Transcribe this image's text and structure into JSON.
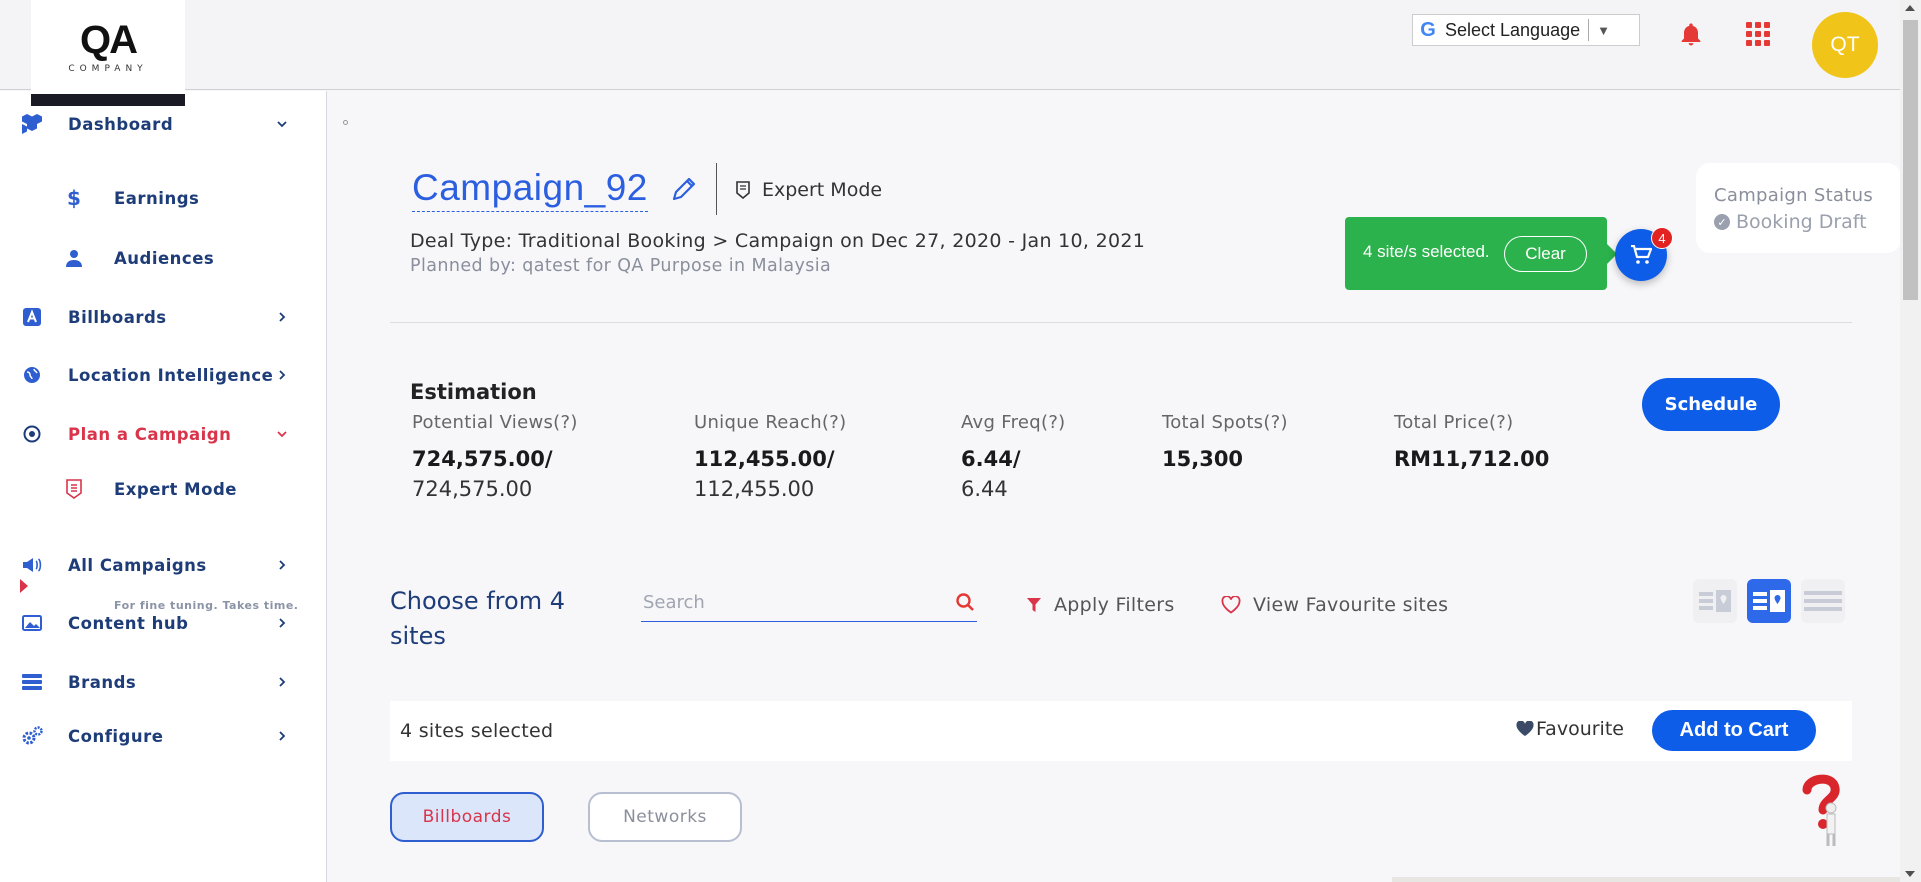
{
  "header": {
    "logo_text": "QA",
    "logo_sub": "COMPANY",
    "language_label": "Select Language",
    "avatar_initials": "QT",
    "accent_color": "#0d5de8",
    "alert_color": "#e53935",
    "avatar_color": "#f0c419"
  },
  "sidebar": {
    "items": [
      {
        "label": "Dashboard",
        "icon": "cubes-icon"
      },
      {
        "label": "Earnings",
        "icon": "dollar-icon"
      },
      {
        "label": "Audiences",
        "icon": "user-icon"
      },
      {
        "label": "Billboards",
        "icon": "billboard-a-icon"
      },
      {
        "label": "Location Intelligence",
        "icon": "globe-icon"
      },
      {
        "label": "Plan a Campaign",
        "icon": "target-icon"
      },
      {
        "label": "Expert Mode",
        "icon": "badge-icon",
        "description": "For fine tuning. Takes time."
      },
      {
        "label": "All Campaigns",
        "icon": "megaphone-icon"
      },
      {
        "label": "Content hub",
        "icon": "image-icon"
      },
      {
        "label": "Brands",
        "icon": "stack-icon"
      },
      {
        "label": "Configure",
        "icon": "gears-icon"
      }
    ]
  },
  "campaign": {
    "title": "Campaign_92",
    "mode": "Expert Mode",
    "deal_line": "Deal Type: Traditional Booking > Campaign on Dec 27, 2020 - Jan 10, 2021",
    "planned_by": "Planned by: qatest for QA Purpose in Malaysia",
    "status_label": "Campaign Status",
    "status_value": "Booking Draft"
  },
  "toast": {
    "message": "4 site/s selected.",
    "clear_label": "Clear",
    "cart_count": "4"
  },
  "estimation": {
    "title": "Estimation",
    "metrics": [
      {
        "label": "Potential Views(?)",
        "value": "724,575.00/",
        "sub": "724,575.00"
      },
      {
        "label": "Unique Reach(?)",
        "value": "112,455.00/",
        "sub": "112,455.00"
      },
      {
        "label": "Avg Freq(?)",
        "value": "6.44/",
        "sub": "6.44"
      },
      {
        "label": "Total Spots(?)",
        "value": "15,300",
        "sub": ""
      },
      {
        "label": "Total Price(?)",
        "value": "RM11,712.00",
        "sub": ""
      }
    ],
    "schedule_label": "Schedule"
  },
  "sites": {
    "choose_text": "Choose from 4 sites",
    "search_placeholder": "Search",
    "filters_label": "Apply Filters",
    "favourites_label": "View Favourite sites",
    "selected_text": "4 sites selected",
    "favourite_label": "Favourite",
    "add_to_cart_label": "Add to Cart"
  },
  "tabs": {
    "billboards": "Billboards",
    "networks": "Networks"
  }
}
